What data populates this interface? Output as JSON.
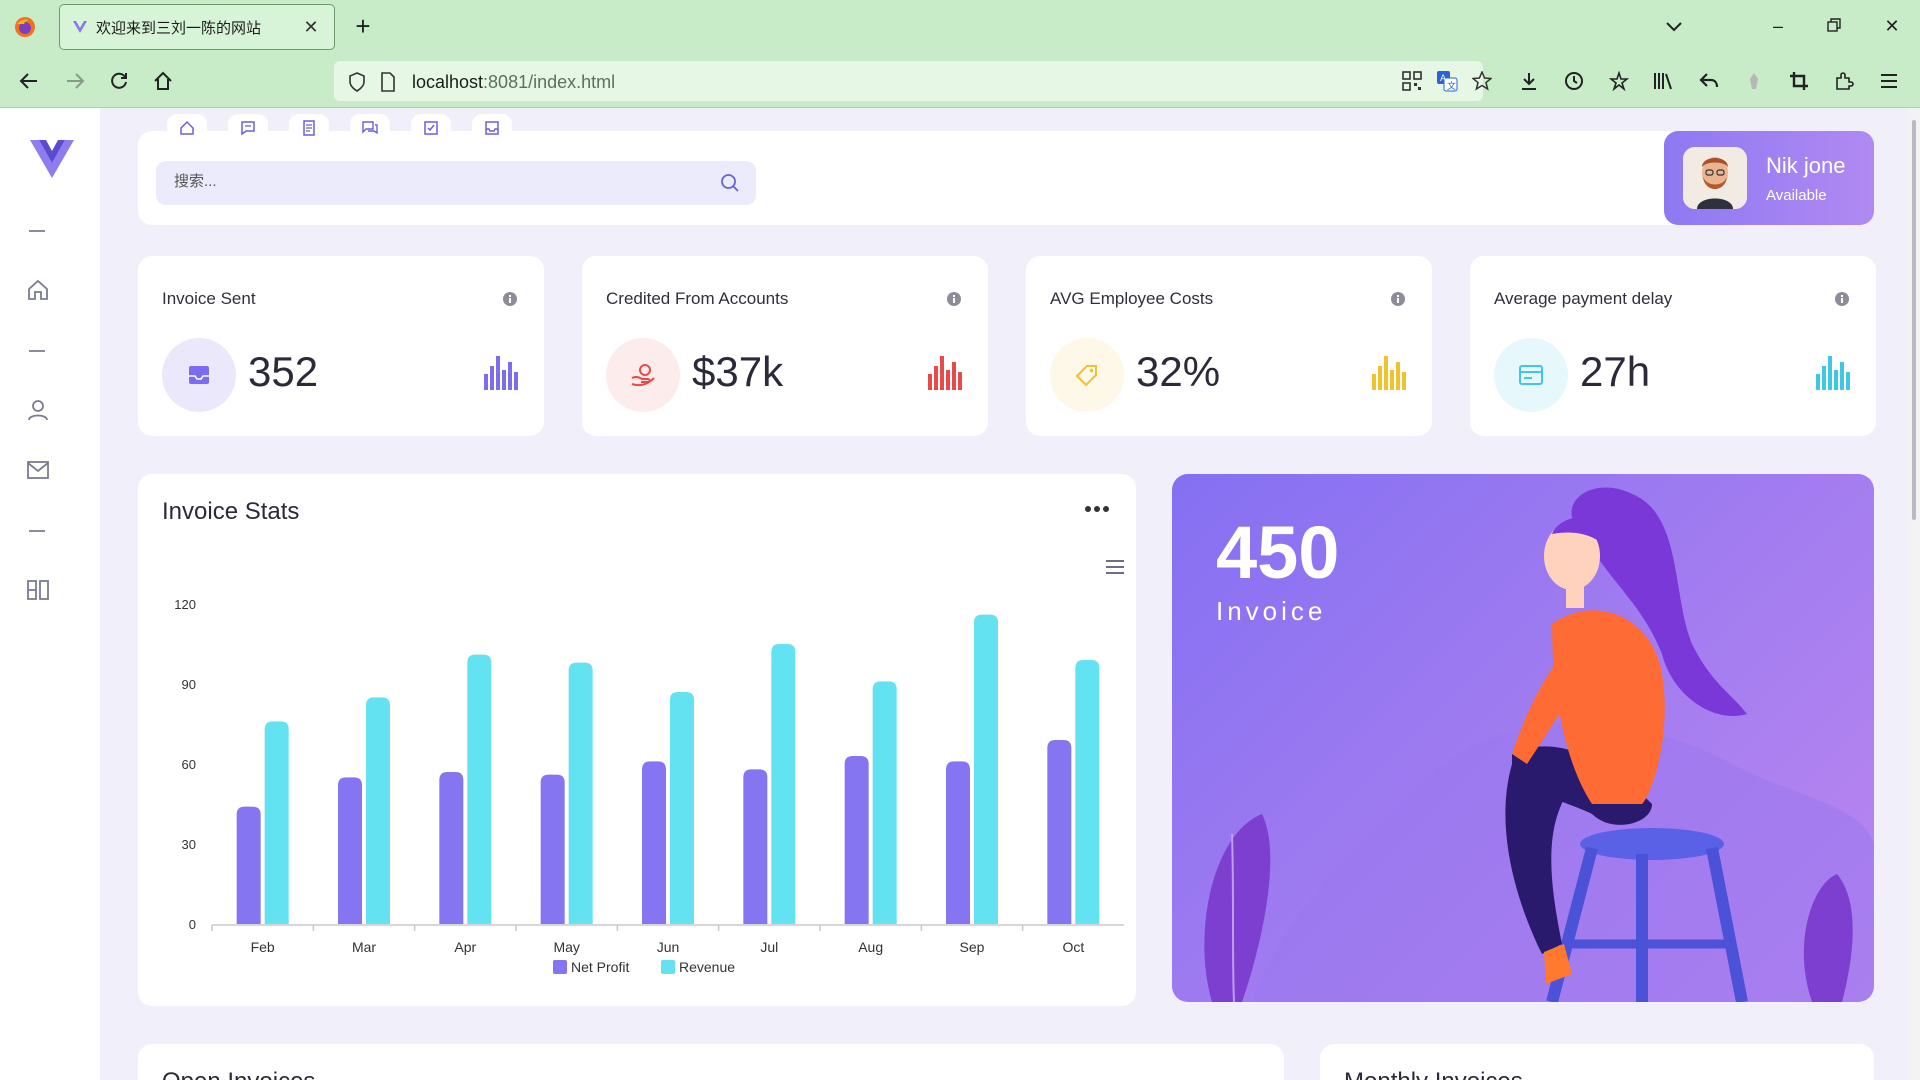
{
  "browser": {
    "tab_title": "欢迎来到三刘一陈的网站",
    "url_host": "localhost",
    "url_rest": ":8081/index.html"
  },
  "header": {
    "search_placeholder": "搜索...",
    "user_name": "Nik jone",
    "user_status": "Available"
  },
  "stats": [
    {
      "title": "Invoice Sent",
      "value": "352",
      "color": "#7b6cf0",
      "icon": "inbox-icon"
    },
    {
      "title": "Credited From Accounts",
      "value": "$37k",
      "color": "#e84a4a",
      "icon": "hand-coin-icon"
    },
    {
      "title": "AVG Employee Costs",
      "value": "32%",
      "color": "#f2c12e",
      "icon": "price-tag-icon"
    },
    {
      "title": "Average payment delay",
      "value": "27h",
      "color": "#3fc7e6",
      "icon": "card-icon"
    }
  ],
  "chart_data": {
    "type": "bar",
    "title": "Invoice Stats",
    "categories": [
      "Feb",
      "Mar",
      "Apr",
      "May",
      "Jun",
      "Jul",
      "Aug",
      "Sep",
      "Oct"
    ],
    "series": [
      {
        "name": "Net Profit",
        "color": "#8575f0",
        "values": [
          44,
          55,
          57,
          56,
          61,
          58,
          63,
          61,
          69
        ]
      },
      {
        "name": "Revenue",
        "color": "#63e2f2",
        "values": [
          76,
          85,
          101,
          98,
          87,
          105,
          91,
          116,
          99
        ]
      }
    ],
    "y_ticks": [
      "0",
      "30",
      "60",
      "90",
      "120"
    ],
    "ylim": [
      0,
      120
    ],
    "legend": "bottom-center"
  },
  "hero": {
    "value": "450",
    "label": "Invoice"
  },
  "bottom": {
    "left_title": "Open Invoices",
    "right_title": "Monthly Invoices"
  }
}
